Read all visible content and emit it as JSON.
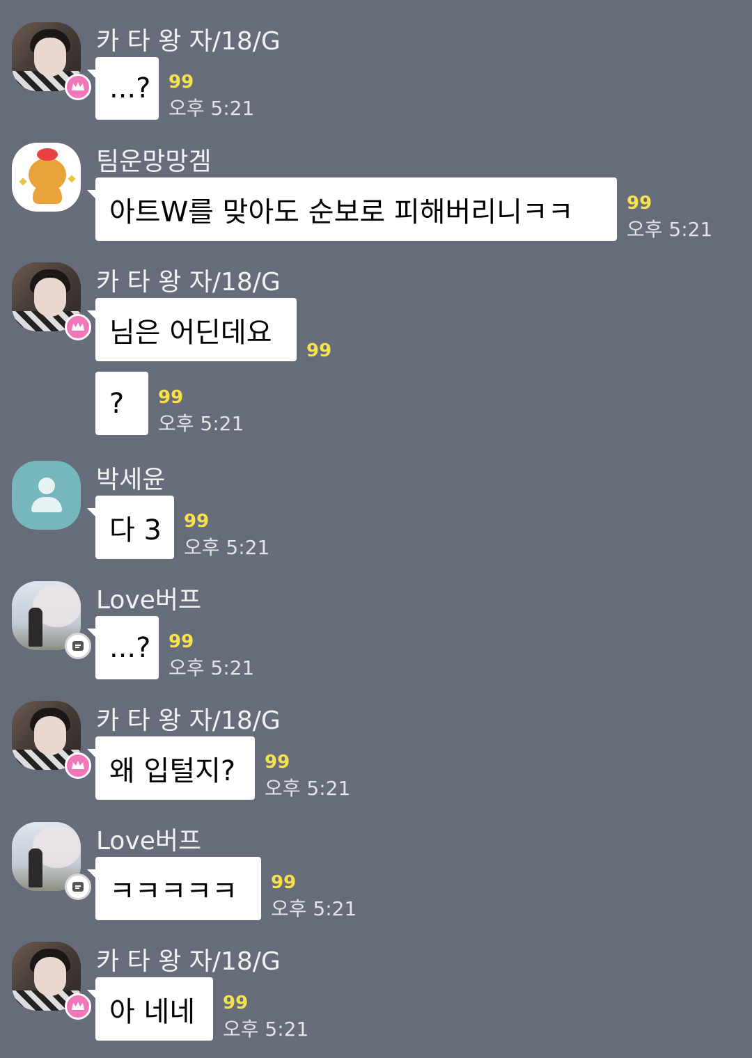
{
  "senders": {
    "katawangja": "카 타 왕 자/18/G",
    "timun": "팀운망망겜",
    "parksy": "박세윤",
    "lovebuff": "Love버프"
  },
  "messages": [
    {
      "sender": "카 타 왕 자/18/G",
      "text": "...?",
      "unread": "99",
      "time": "오후 5:21"
    },
    {
      "sender": "팀운망망겜",
      "text": "아트W를 맞아도 순보로 피해버리니ㅋㅋ",
      "unread": "99",
      "time": "오후 5:21"
    },
    {
      "sender": "카 타 왕 자/18/G",
      "text": "님은 어딘데요",
      "unread": "99"
    },
    {
      "text": "?",
      "unread": "99",
      "time": "오후 5:21"
    },
    {
      "sender": "박세윤",
      "text": "다 3",
      "unread": "99",
      "time": "오후 5:21"
    },
    {
      "sender": "Love버프",
      "text": "...?",
      "unread": "99",
      "time": "오후 5:21"
    },
    {
      "sender": "카 타 왕 자/18/G",
      "text": "왜 입털지?",
      "unread": "99",
      "time": "오후 5:21"
    },
    {
      "sender": "Love버프",
      "text": "ㅋㅋㅋㅋㅋ",
      "unread": "99",
      "time": "오후 5:21"
    },
    {
      "sender": "카 타 왕 자/18/G",
      "text": "아 네네",
      "unread": "99",
      "time": "오후 5:21"
    }
  ],
  "colors": {
    "background": "#666c79",
    "bubble": "#ffffff",
    "unread": "#f7e24b",
    "crown_badge": "#f277b8",
    "default_avatar": "#75b7bd"
  },
  "icons": {
    "crown": "crown-icon",
    "chat": "chat-bubble-icon",
    "person": "person-icon"
  }
}
